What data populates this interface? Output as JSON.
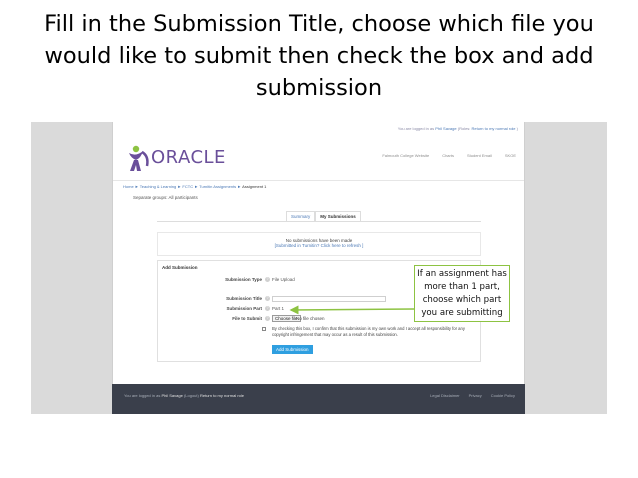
{
  "slide": {
    "title": "Fill in the Submission Title, choose which file you would like to submit then check the box and add submission"
  },
  "top_strip": {
    "prefix": "You are logged in as",
    "user": "Phil Savage",
    "sep": "(Roles: ",
    "link": "Return to my normal role",
    "suffix": ")"
  },
  "header": {
    "logo_text": "ORACLE",
    "nav": [
      "Falmouth College Website",
      "Charts",
      "Student Email",
      "SKOE"
    ]
  },
  "breadcrumb": {
    "trail": "Home ► Teaching & Learning ► FCTC ► Turnitin Assignments ►",
    "current": "Assignment 1"
  },
  "groups_label": "Separate groups: All participants",
  "tabs": [
    {
      "label": "Summary",
      "active": false
    },
    {
      "label": "My Submissions",
      "active": true
    }
  ],
  "notice": {
    "line1": "No submissions have been made",
    "link": "[Submitted in Turnitin? Click here to refresh ]"
  },
  "form": {
    "heading": "Add Submission",
    "submission_type_label": "Submission Type",
    "submission_type_value": "File Upload",
    "submission_title_label": "Submission Title",
    "submission_part_label": "Submission Part",
    "submission_part_value": "Part 1",
    "file_label": "File to Submit",
    "file_button": "Choose file",
    "file_none": "No file chosen",
    "declaration": "By checking this box, I confirm that this submission is my own work and I accept all responsibility for any copyright infringement that may occur as a result of this submission.",
    "submit_button": "Add Submission",
    "help_glyph": "?"
  },
  "callout": {
    "text": "If an assignment has more than 1 part, choose which part you are submitting",
    "border_color": "#8dc342"
  },
  "footer": {
    "prefix": "You are logged in as",
    "user": "Phil Savage",
    "logout": "(Logout)",
    "link": "Return to my normal role",
    "right_links": [
      "Legal Disclaimer",
      "Privacy",
      "Cookie Policy"
    ]
  }
}
